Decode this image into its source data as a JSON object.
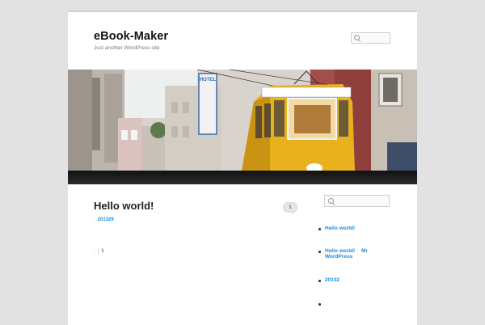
{
  "site": {
    "title": "eBook-Maker",
    "description": "Just another WordPress site"
  },
  "header_search": {
    "placeholder": ""
  },
  "hero": {
    "sign_text": "HOTEL"
  },
  "post": {
    "title": "Hello world!",
    "comment_count": "1",
    "date_link": "201329",
    "footer_link": "1"
  },
  "sidebar": {
    "search_placeholder": "",
    "items": [
      {
        "label": "Hello world!"
      },
      {
        "label": "Hello world!",
        "label2": "Mr",
        "label3": "WordPress"
      },
      {
        "label": "20132"
      },
      {
        "label": ""
      }
    ]
  },
  "colors": {
    "link": "#1b8be0",
    "page_bg": "#e2e2e2",
    "tram_yellow": "#e8b21f"
  }
}
